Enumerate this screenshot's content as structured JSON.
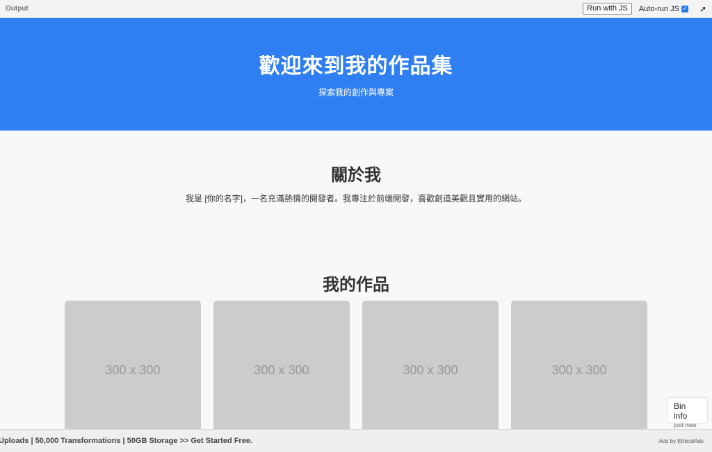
{
  "toolbar": {
    "output_label": "Output",
    "run_button": "Run with JS",
    "autorun_label": "Auto-run JS",
    "autorun_checked": true
  },
  "hero": {
    "title": "歡迎來到我的作品集",
    "subtitle": "探索我的創作與專案"
  },
  "about": {
    "title": "關於我",
    "text": "我是 [你的名字]，一名充滿熱情的開發者。我專注於前端開發，喜歡創造美觀且實用的網站。"
  },
  "works": {
    "title": "我的作品",
    "items": [
      {
        "placeholder": "300 x 300"
      },
      {
        "placeholder": "300 x 300"
      },
      {
        "placeholder": "300 x 300"
      },
      {
        "placeholder": "300 x 300"
      }
    ]
  },
  "bin_info": {
    "title": "Bin info",
    "time": "just now"
  },
  "ad": {
    "text": "Uploads | 50,000 Transformations | 50GB Storage >> Get Started Free.",
    "by": "Ads by EthicalAds"
  },
  "colors": {
    "hero_bg": "#2f7ff2",
    "card_bg": "#cccccc"
  }
}
